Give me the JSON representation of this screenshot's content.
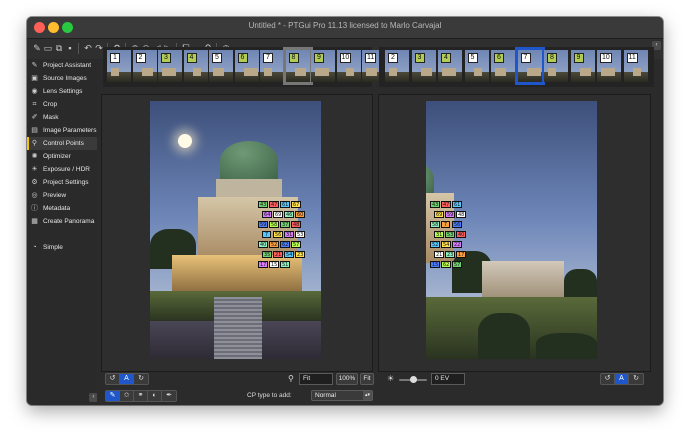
{
  "window": {
    "title": "Untitled * - PTGui Pro 11.13 licensed to Marlo Carvajal"
  },
  "toolbar": {
    "icons": [
      "new-icon",
      "open-icon",
      "copy-icon",
      "save-icon",
      "undo-icon",
      "redo-icon",
      "gear-icon",
      "zoom-in-icon",
      "zoom-out-icon",
      "previous-icon",
      "next-icon",
      "panorama-icon",
      "image-icon",
      "pin-icon",
      "clock-icon"
    ]
  },
  "sidebar": {
    "items": [
      {
        "label": "Project Assistant",
        "icon": "assistant-icon",
        "glyph": "✎"
      },
      {
        "label": "Source Images",
        "icon": "images-icon",
        "glyph": "▣"
      },
      {
        "label": "Lens Settings",
        "icon": "lens-icon",
        "glyph": "◉"
      },
      {
        "label": "Crop",
        "icon": "crop-icon",
        "glyph": "⌗"
      },
      {
        "label": "Mask",
        "icon": "mask-icon",
        "glyph": "✐"
      },
      {
        "label": "Image Parameters",
        "icon": "parameters-icon",
        "glyph": "▤"
      },
      {
        "label": "Control Points",
        "icon": "control-points-icon",
        "glyph": "⚲"
      },
      {
        "label": "Optimizer",
        "icon": "optimizer-icon",
        "glyph": "✺"
      },
      {
        "label": "Exposure / HDR",
        "icon": "exposure-icon",
        "glyph": "☀"
      },
      {
        "label": "Project Settings",
        "icon": "settings-icon",
        "glyph": "⚙"
      },
      {
        "label": "Preview",
        "icon": "preview-icon",
        "glyph": "◎"
      },
      {
        "label": "Metadata",
        "icon": "metadata-icon",
        "glyph": "ⓘ"
      },
      {
        "label": "Create Panorama",
        "icon": "create-panorama-icon",
        "glyph": "▦"
      }
    ],
    "simple_label": "Simple",
    "active_index": 6
  },
  "left_strip": {
    "thumbs": [
      "1",
      "2",
      "3",
      "4",
      "5",
      "6",
      "7",
      "8",
      "9",
      "10",
      "11"
    ],
    "selected": "8"
  },
  "right_strip": {
    "thumbs": [
      "2",
      "3",
      "4",
      "5",
      "6",
      "7",
      "8",
      "9",
      "10",
      "11"
    ],
    "selected": "7"
  },
  "control_points": {
    "left": [
      "43",
      "47",
      "61",
      "67",
      "64",
      "69",
      "46",
      "60",
      "59",
      "58",
      "37",
      "48",
      "7",
      "56",
      "31",
      "53",
      "40",
      "52",
      "62",
      "57",
      "35",
      "21",
      "54",
      "23",
      "17",
      "15",
      "51"
    ],
    "right": [
      "43",
      "47",
      "61",
      "69",
      "59",
      "48",
      "58",
      "7",
      "56",
      "31",
      "53",
      "40",
      "52",
      "54",
      "22",
      "21",
      "23",
      "17",
      "15",
      "62",
      "57"
    ]
  },
  "bottom_left": {
    "auto_label": "A"
  },
  "zoom": {
    "fit_input": "Fit",
    "percent_button": "100%",
    "fit_button": "Fit"
  },
  "exposure": {
    "value": "0 EV",
    "slider_position": 0.5
  },
  "bottom_right": {
    "auto_label": "A"
  },
  "footer": {
    "cp_type_label": "CP type to add:",
    "cp_type_value": "Normal"
  },
  "colors": {
    "accent": "#1f56c9",
    "active_marker": "#f2c40d"
  }
}
